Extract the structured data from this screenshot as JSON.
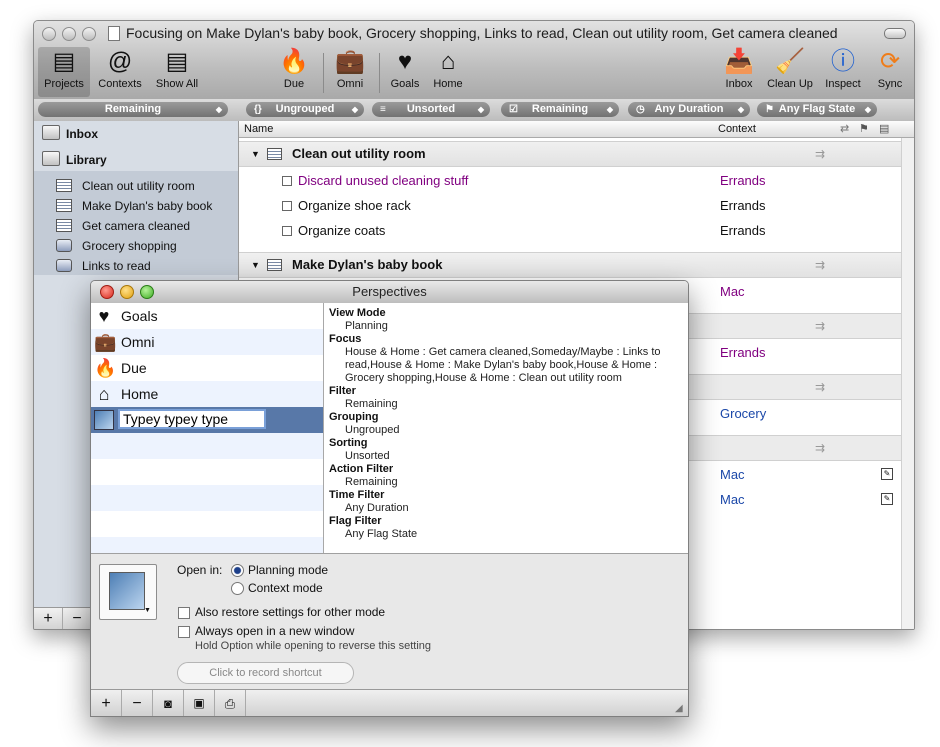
{
  "main_window": {
    "title": "Focusing on Make Dylan's baby book, Grocery shopping, Links to read, Clean out utility room, Get camera cleaned",
    "toolbar": {
      "projects": "Projects",
      "contexts": "Contexts",
      "show_all": "Show All",
      "due": "Due",
      "omni": "Omni",
      "goals": "Goals",
      "home": "Home",
      "inbox": "Inbox",
      "clean_up": "Clean Up",
      "inspect": "Inspect",
      "sync": "Sync"
    },
    "scope": {
      "sidebar_filter": "Remaining",
      "grouping": "Ungrouped",
      "sorting": "Unsorted",
      "status": "Remaining",
      "duration": "Any Duration",
      "flag": "Any Flag State"
    },
    "sidebar": {
      "inbox": "Inbox",
      "library": "Library",
      "items": [
        {
          "label": "Clean out utility room"
        },
        {
          "label": "Make Dylan's baby book"
        },
        {
          "label": "Get camera cleaned"
        },
        {
          "label": "Grocery shopping"
        },
        {
          "label": "Links to read"
        }
      ]
    },
    "columns": {
      "name": "Name",
      "context": "Context"
    },
    "groups": [
      {
        "title": "Clean out utility room",
        "actions": [
          {
            "name": "Discard unused cleaning stuff",
            "context": "Errands"
          },
          {
            "name": "Organize shoe rack",
            "context": "Errands"
          },
          {
            "name": "Organize coats",
            "context": "Errands"
          }
        ]
      },
      {
        "title": "Make Dylan's baby book"
      }
    ],
    "hidden_contexts": [
      "Mac",
      "Errands",
      "Grocery",
      "Mac",
      "Mac"
    ],
    "colors": {
      "overdue_purple": "#800080",
      "context_blue": "#1a47a8"
    }
  },
  "perspectives": {
    "title": "Perspectives",
    "list": [
      {
        "label": "Goals",
        "icon": "heart-icon"
      },
      {
        "label": "Omni",
        "icon": "briefcase-icon"
      },
      {
        "label": "Due",
        "icon": "fire-icon"
      },
      {
        "label": "Home",
        "icon": "house-icon"
      }
    ],
    "editing_value": "Typey typey type",
    "details": [
      {
        "heading": "View Mode",
        "value": "Planning"
      },
      {
        "heading": "Focus",
        "value": "House & Home : Get camera cleaned,Someday/Maybe : Links to read,House & Home : Make Dylan's baby book,House & Home : Grocery shopping,House & Home : Clean out utility room"
      },
      {
        "heading": "Filter",
        "value": "Remaining"
      },
      {
        "heading": "Grouping",
        "value": "Ungrouped"
      },
      {
        "heading": "Sorting",
        "value": "Unsorted"
      },
      {
        "heading": "Action Filter",
        "value": "Remaining"
      },
      {
        "heading": "Time Filter",
        "value": "Any Duration"
      },
      {
        "heading": "Flag Filter",
        "value": "Any Flag State"
      }
    ],
    "open_in_label": "Open in:",
    "planning_mode": "Planning mode",
    "context_mode": "Context mode",
    "also_restore": "Also restore settings for other mode",
    "always_new_window": "Always open in a new window",
    "hint": "Hold Option while opening to reverse this setting",
    "record_shortcut": "Click to record shortcut"
  }
}
